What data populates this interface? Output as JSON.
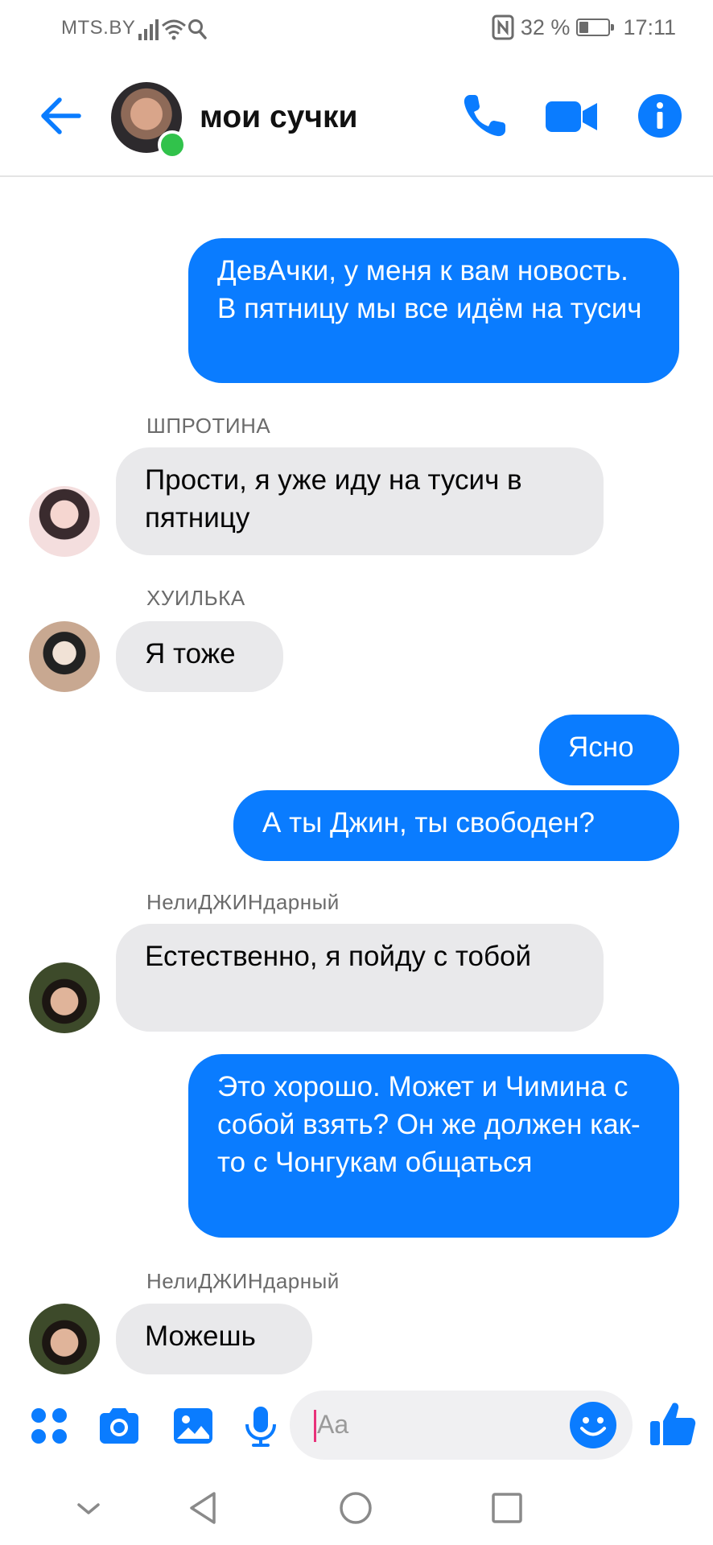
{
  "status_bar": {
    "carrier": "MTS.BY",
    "battery_percent": "32 %",
    "battery_level": 0.32,
    "time": "17:11"
  },
  "header": {
    "title": "мои сучки",
    "icons": [
      "back-arrow-icon",
      "phone-icon",
      "video-camera-icon",
      "info-icon"
    ],
    "accent": "#0a7cff"
  },
  "messages": [
    {
      "direction": "out",
      "text": "ДевАчки, у меня к вам новость. В пятницу мы все идём на тусич"
    },
    {
      "direction": "in",
      "sender": "ШПРОТИНА",
      "text": "Прости, я уже иду на тусич в пятницу"
    },
    {
      "direction": "in",
      "sender": "ХУИЛЬКА",
      "text": "Я тоже"
    },
    {
      "direction": "out",
      "text": "Ясно"
    },
    {
      "direction": "out",
      "text": "А ты Джин, ты свободен?"
    },
    {
      "direction": "in",
      "sender": "НелиДЖИНдарный",
      "text": "Естественно, я пойду с тобой"
    },
    {
      "direction": "out",
      "text": "Это хорошо. Может и Чимина с собой взять? Он же должен как-то с Чонгукам общаться"
    },
    {
      "direction": "in",
      "sender": "НелиДЖИНдарный",
      "text": "Можешь"
    }
  ],
  "composer": {
    "placeholder": "Aa",
    "icons": [
      "apps-icon",
      "camera-icon",
      "gallery-icon",
      "microphone-icon",
      "emoji-icon",
      "thumbs-up-icon"
    ]
  },
  "nav_bar": {
    "icons": [
      "collapse-icon",
      "back-icon",
      "home-icon",
      "recents-icon"
    ]
  },
  "colors": {
    "outgoing_bubble": "#0a7cff",
    "incoming_bubble": "#e9e9eb",
    "online": "#31c24b"
  }
}
